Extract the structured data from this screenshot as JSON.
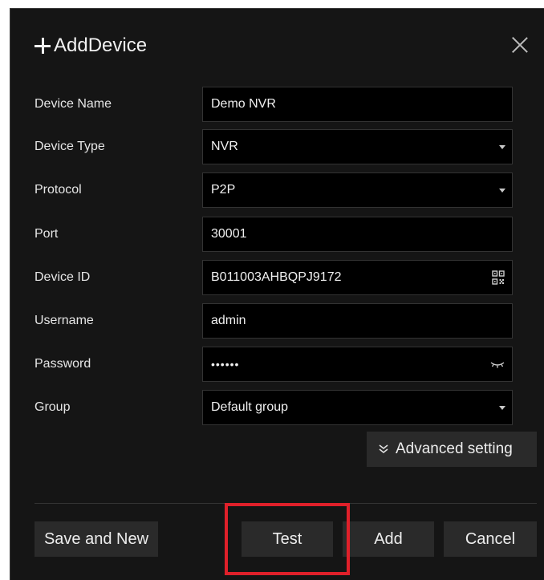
{
  "dialog": {
    "title": "AddDevice"
  },
  "fields": [
    {
      "label": "Device Name",
      "value": "Demo NVR",
      "kind": "text"
    },
    {
      "label": "Device Type",
      "value": "NVR",
      "kind": "select"
    },
    {
      "label": "Protocol",
      "value": "P2P",
      "kind": "select"
    },
    {
      "label": "Port",
      "value": "30001",
      "kind": "text"
    },
    {
      "label": "Device ID",
      "value": "B011003AHBQPJ9172",
      "kind": "text-qr"
    },
    {
      "label": "Username",
      "value": "admin",
      "kind": "text"
    },
    {
      "label": "Password",
      "value": "••••••",
      "kind": "password"
    },
    {
      "label": "Group",
      "value": "Default group",
      "kind": "select"
    }
  ],
  "advanced": {
    "label": "Advanced setting"
  },
  "buttons": {
    "save_new": "Save and New",
    "test": "Test",
    "add": "Add",
    "cancel": "Cancel"
  },
  "colors": {
    "background": "#151515",
    "field_bg": "#000000",
    "button_bg": "#2a2a2a",
    "highlight": "#e0202a"
  },
  "icons": {
    "title": "plus-icon",
    "close": "close-icon",
    "select": "chevron-down-icon",
    "device_id": "qr-code-icon",
    "password": "eye-closed-icon",
    "advanced": "double-chevron-down-icon"
  }
}
